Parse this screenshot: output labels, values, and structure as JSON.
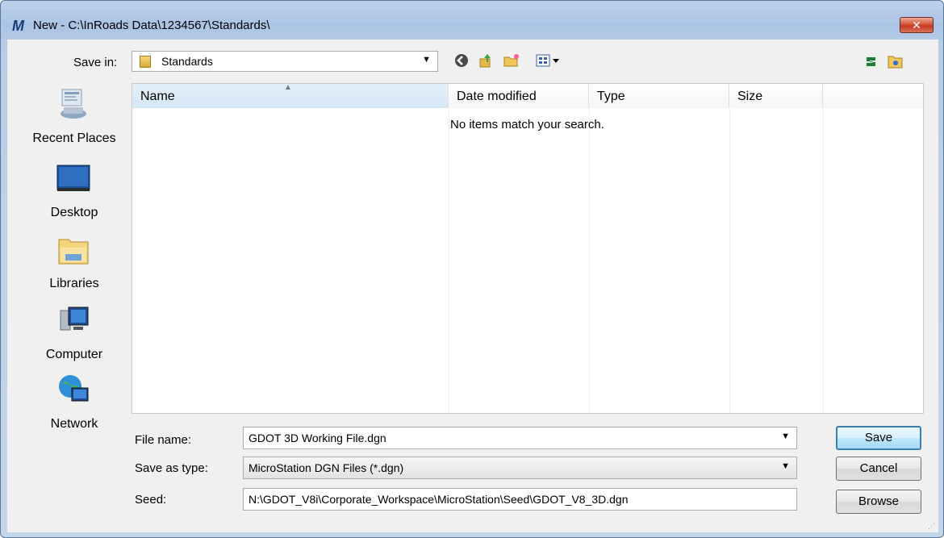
{
  "window": {
    "title": "New - C:\\InRoads Data\\1234567\\Standards\\",
    "close_label": "✕"
  },
  "savein": {
    "label": "Save in:",
    "value": "Standards"
  },
  "toolbar": {
    "icons": [
      "back-icon",
      "up-folder-icon",
      "new-folder-icon",
      "view-menu-icon",
      "refresh-icon",
      "browse-folder-icon"
    ]
  },
  "places": [
    {
      "label": "Recent Places",
      "icon": "recent-places-icon"
    },
    {
      "label": "Desktop",
      "icon": "desktop-icon"
    },
    {
      "label": "Libraries",
      "icon": "libraries-icon"
    },
    {
      "label": "Computer",
      "icon": "computer-icon"
    },
    {
      "label": "Network",
      "icon": "network-icon"
    }
  ],
  "filelist": {
    "columns": [
      "Name",
      "Date modified",
      "Type",
      "Size"
    ],
    "empty_message": "No items match your search."
  },
  "form": {
    "file_name_label": "File name:",
    "file_name_value": "GDOT 3D Working File.dgn",
    "save_type_label": "Save as type:",
    "save_type_value": "MicroStation DGN Files (*.dgn)",
    "seed_label": "Seed:",
    "seed_value": "N:\\GDOT_V8i\\Corporate_Workspace\\MicroStation\\Seed\\GDOT_V8_3D.dgn"
  },
  "buttons": {
    "save": "Save",
    "cancel": "Cancel",
    "browse": "Browse"
  }
}
